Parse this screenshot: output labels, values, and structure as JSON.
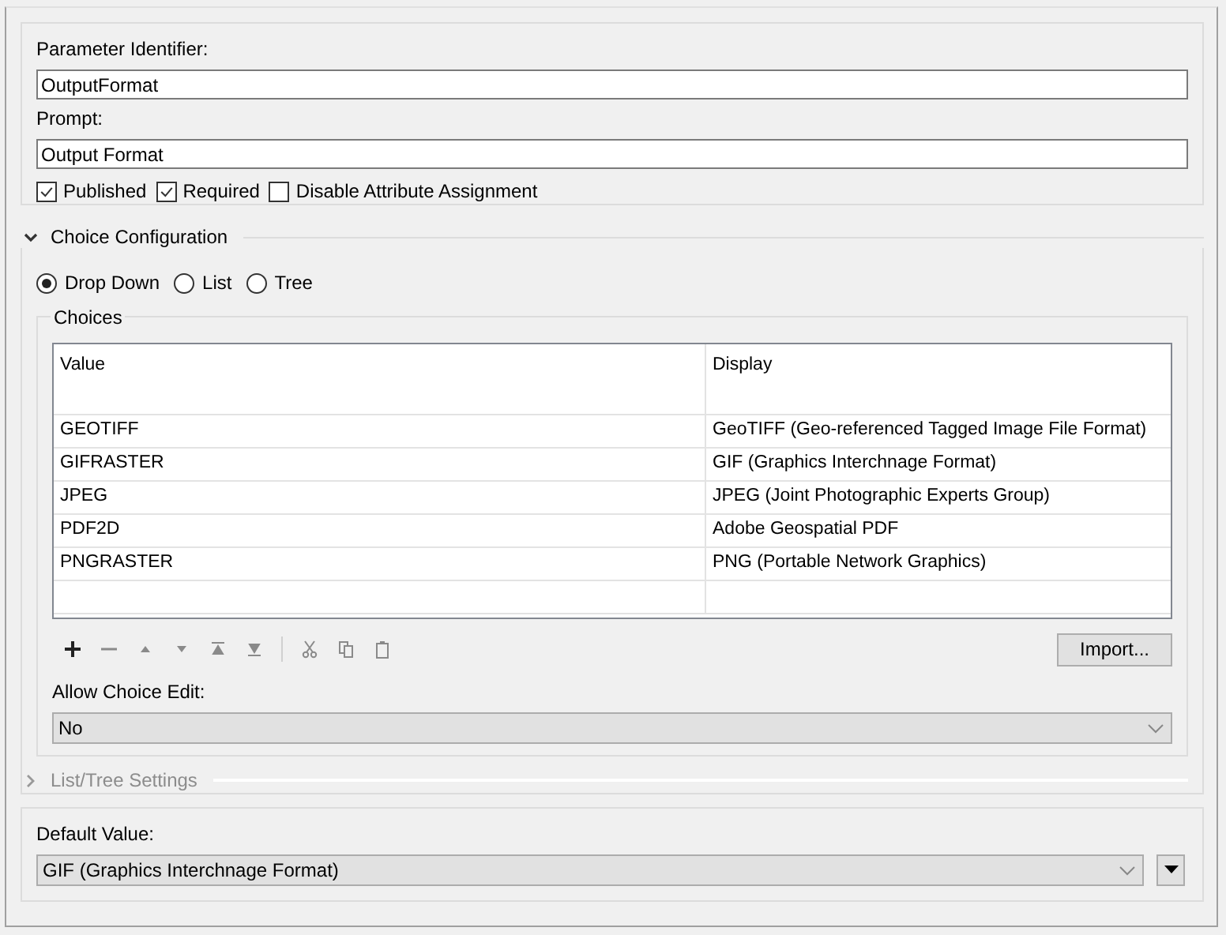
{
  "identifier": {
    "label": "Parameter Identifier:",
    "value": "OutputFormat"
  },
  "prompt": {
    "label": "Prompt:",
    "value": "Output Format"
  },
  "options": [
    {
      "label": "Published",
      "checked": true
    },
    {
      "label": "Required",
      "checked": true
    },
    {
      "label": "Disable Attribute Assignment",
      "checked": false
    }
  ],
  "choice_configuration": {
    "title": "Choice Configuration",
    "expanded": true,
    "styles": [
      {
        "label": "Drop Down",
        "selected": true
      },
      {
        "label": "List",
        "selected": false
      },
      {
        "label": "Tree",
        "selected": false
      }
    ],
    "choices": {
      "title": "Choices",
      "columns": [
        "Value",
        "Display"
      ],
      "rows": [
        [
          "GEOTIFF",
          "GeoTIFF (Geo-referenced Tagged Image File Format)"
        ],
        [
          "GIFRASTER",
          "GIF (Graphics Interchnage Format)"
        ],
        [
          "JPEG",
          "JPEG (Joint Photographic Experts Group)"
        ],
        [
          "PDF2D",
          "Adobe Geospatial PDF"
        ],
        [
          "PNGRASTER",
          "PNG (Portable Network Graphics)"
        ]
      ],
      "import_button": "Import...",
      "allow_choice_edit": {
        "label": "Allow Choice Edit:",
        "value": "No"
      }
    }
  },
  "list_tree_settings": {
    "title": "List/Tree Settings",
    "expanded": false,
    "disabled": true
  },
  "default_value": {
    "label": "Default Value:",
    "value": "GIF (Graphics Interchnage Format)"
  }
}
